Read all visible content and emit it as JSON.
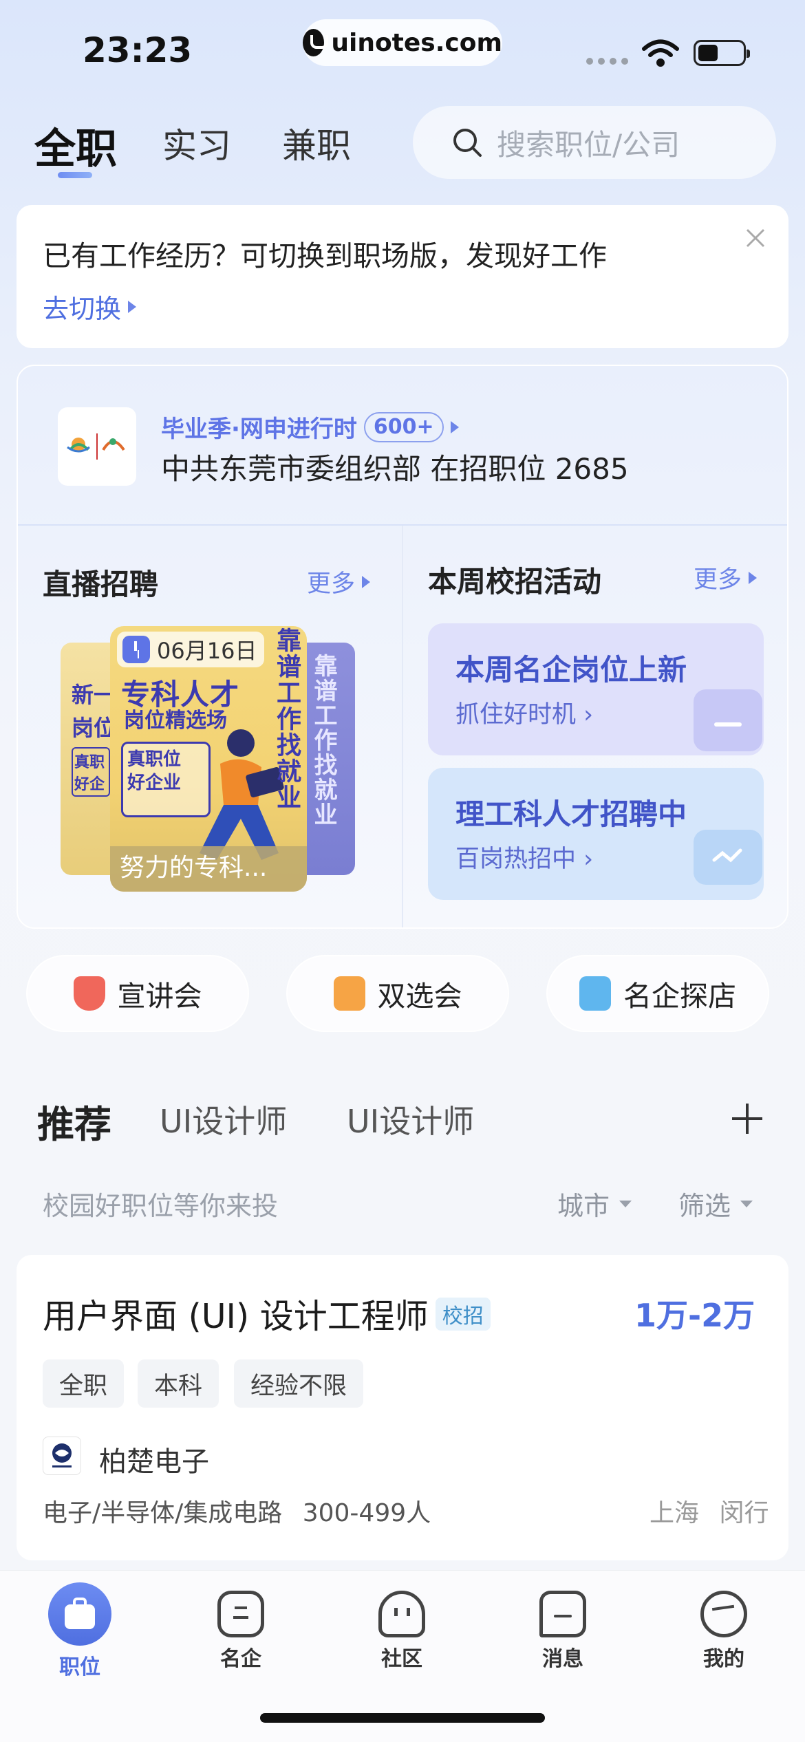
{
  "status_bar": {
    "time": "23:23",
    "url": "uinotes.com"
  },
  "top_tabs": [
    {
      "label": "全职",
      "active": true
    },
    {
      "label": "实习",
      "active": false
    },
    {
      "label": "兼职",
      "active": false
    }
  ],
  "search": {
    "placeholder": "搜索职位/公司",
    "icon": "search-icon"
  },
  "switch_notice": {
    "text": "已有工作经历？可切换到职场版，发现好工作",
    "link": "去切换"
  },
  "graduation_banner": {
    "title": "毕业季·网申进行时",
    "badge": "600+",
    "subtitle": "中共东莞市委组织部 在招职位 2685"
  },
  "live_section": {
    "title": "直播招聘",
    "more": "更多",
    "poster": {
      "date": "06月16日",
      "headline": "专科人才",
      "subheadline": "岗位精选场",
      "tag_line1": "真职位",
      "tag_line2": "好企业",
      "side_text": "靠谱工作找就业",
      "caption": "努力的专科..."
    },
    "back_poster_left": {
      "line1": "新一",
      "line2": "岗位",
      "tag": "真职 好企"
    }
  },
  "campus_section": {
    "title": "本周校招活动",
    "more": "更多",
    "cards": [
      {
        "title": "本周名企岗位上新",
        "sub": "抓住好时机",
        "color": "#dfe0fb"
      },
      {
        "title": "理工科人才招聘中",
        "sub": "百岗热招中",
        "color": "#d5e6fb"
      }
    ]
  },
  "quick_entries": [
    {
      "label": "宣讲会",
      "icon": "lecture-icon",
      "color": "#f0675b"
    },
    {
      "label": "双选会",
      "icon": "check-card-icon",
      "color": "#f6a445"
    },
    {
      "label": "名企探店",
      "icon": "building-icon",
      "color": "#5fb6ee"
    }
  ],
  "recommend_tabs": [
    {
      "label": "推荐",
      "active": true
    },
    {
      "label": "UI设计师",
      "active": false
    },
    {
      "label": "UI设计师",
      "active": false
    }
  ],
  "filter_bar": {
    "hint": "校园好职位等你来投",
    "city": "城市",
    "filter": "筛选"
  },
  "job": {
    "title": "用户界面 (UI) 设计工程师",
    "badge": "校招",
    "salary": "1万-2万",
    "tags": [
      "全职",
      "本科",
      "经验不限"
    ],
    "company": "柏楚电子",
    "industry": "电子/半导体/集成电路",
    "size": "300-499人",
    "city": "上海",
    "district": "闵行"
  },
  "bottom_nav": [
    {
      "label": "职位",
      "icon": "briefcase-icon",
      "active": true
    },
    {
      "label": "名企",
      "icon": "company-icon",
      "active": false
    },
    {
      "label": "社区",
      "icon": "community-icon",
      "active": false
    },
    {
      "label": "消息",
      "icon": "message-icon",
      "active": false
    },
    {
      "label": "我的",
      "icon": "profile-icon",
      "active": false
    }
  ]
}
